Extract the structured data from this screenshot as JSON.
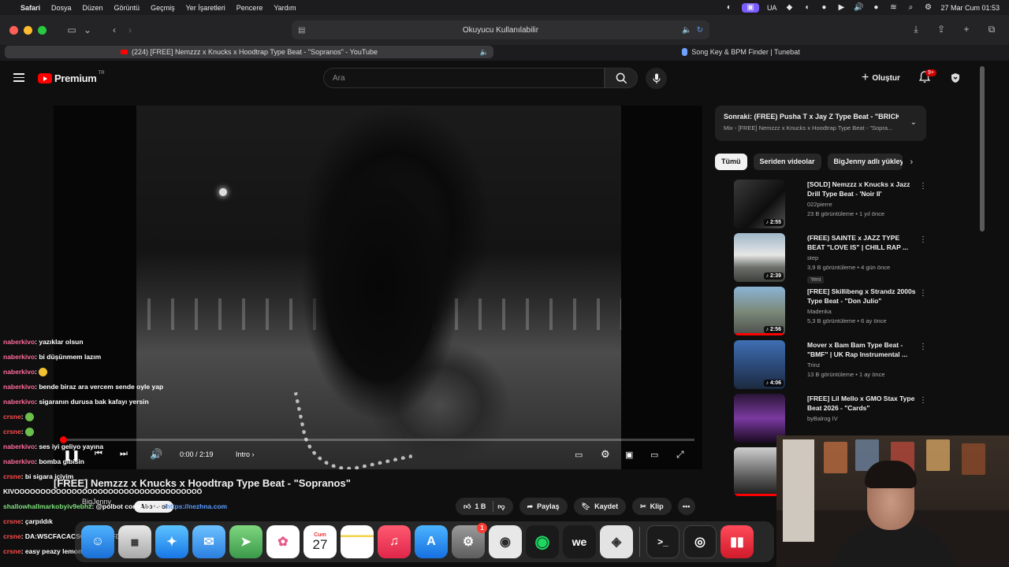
{
  "menubar": {
    "app": "Safari",
    "items": [
      "Dosya",
      "Düzen",
      "Görüntü",
      "Geçmiş",
      "Yer İşaretleri",
      "Pencere",
      "Yardım"
    ],
    "lang": "UA",
    "datetime": "27 Mar Cum  01:53"
  },
  "safari": {
    "address_text": "Okuyucu Kullanılabilir",
    "tabs": [
      {
        "label": "(224) [FREE] Nemzzz x Knucks x Hoodtrap Type Beat - \"Sopranos\" - YouTube",
        "active": true
      },
      {
        "label": "Song Key & BPM Finder | Tunebat",
        "active": false
      }
    ]
  },
  "yt": {
    "logo_text": "Premium",
    "logo_region": "TR",
    "search_placeholder": "Ara",
    "create_label": "Oluştur",
    "notif_badge": "9+"
  },
  "player": {
    "time": "0:00 / 2:19",
    "chapter": "Intro",
    "progress": 0.0
  },
  "video": {
    "title": "[FREE] Nemzzz x Knucks x Hoodtrap Type Beat - \"Sopranos\"",
    "channel": "BigJenny",
    "subscribe_label": "Abone ol",
    "likes": "1 B",
    "share": "Paylaş",
    "save": "Kaydet",
    "clip": "Klip"
  },
  "sidebar": {
    "next_title": "Sonraki: (FREE) Pusha T x Jay Z Type Beat - \"BRICK...",
    "next_sub": "Mix - [FREE] Nemzzz x Knucks x Hoodtrap Type Beat - \"Sopra...",
    "chips": [
      "Tümü",
      "Seriden videolar",
      "BigJenny adlı yükleyic"
    ],
    "items": [
      {
        "title": "[SOLD] Nemzzz x Knucks x Jazz Drill Type Beat - 'Noir II'",
        "channel": "022pierre",
        "meta": "23 B görüntüleme • 1 yıl önce",
        "duration": "2:55",
        "tag": ""
      },
      {
        "title": "(FREE) SAINTE x JAZZ TYPE BEAT \"LOVE IS\" | CHILL RAP ...",
        "channel": "step",
        "meta": "3,9 B görüntüleme • 4 gün önce",
        "duration": "2:39",
        "tag": "Yeni"
      },
      {
        "title": "[FREE] Skillibeng x Strandz 2000s Type Beat - \"Don Julio\"",
        "channel": "Madenka",
        "meta": "5,3 B görüntüleme • 6 ay önce",
        "duration": "2:56",
        "tag": ""
      },
      {
        "title": "Mover x Bam Bam Type Beat - \"BMF\" | UK Rap Instrumental ...",
        "channel": "Trinz",
        "meta": "13 B görüntüleme • 1 ay önce",
        "duration": "4:06",
        "tag": ""
      },
      {
        "title": "[FREE] Lil Mello x GMO Stax Type Beat 2026 - \"Cards\"",
        "channel": "byBalrog IV",
        "meta": "",
        "duration": "",
        "tag": ""
      }
    ]
  },
  "chat": [
    {
      "user": "naberkivo",
      "color": "#ff6b9a",
      "msg": ": yazıklar olsun"
    },
    {
      "user": "naberkivo",
      "color": "#ff6b9a",
      "msg": ": bi düşünmem lazım"
    },
    {
      "user": "naberkivo",
      "color": "#ff6b9a",
      "msg": ": ",
      "emoji": "y"
    },
    {
      "user": "naberkivo",
      "color": "#ff6b9a",
      "msg": ": bende biraz ara vercem sende oyle yap"
    },
    {
      "user": "naberkivo",
      "color": "#ff6b9a",
      "msg": ": sigaranın durusa bak kafayı yersin"
    },
    {
      "user": "crsne",
      "color": "#ff4d4d",
      "msg": ": ",
      "emoji": "g"
    },
    {
      "user": "crsne",
      "color": "#ff4d4d",
      "msg": ": ",
      "emoji": "g"
    },
    {
      "user": "naberkivo",
      "color": "#ff6b9a",
      "msg": ": ses iyi geliyo yayına"
    },
    {
      "user": "naberkivo",
      "color": "#ff6b9a",
      "msg": ": bomba gibisin"
    },
    {
      "user": "crsne",
      "color": "#ff4d4d",
      "msg": ": bi sigara içiyim"
    },
    {
      "user": "",
      "color": "#ffffff",
      "msg": "KIVOOOOOOOOOOOOOOOOOOOOOOOOOOOOOOOOOOOÖ"
    },
    {
      "user": "shallowhallmarkobyiv9ebhz",
      "color": "#7ee07e",
      "msg": ": @polbot come to us - ",
      "link": "https://nezhna.com"
    },
    {
      "user": "crsne",
      "color": "#ff4d4d",
      "msg": ": çarpıldık"
    },
    {
      "user": "crsne",
      "color": "#ff4d4d",
      "msg": ": DA:WSCFACACSQACWQAFDC"
    },
    {
      "user": "crsne",
      "color": "#ff4d4d",
      "msg": ": easy peazy lemon squezy"
    }
  ],
  "dock": {
    "calendar_month": "Cum",
    "calendar_day": "27",
    "settings_badge": "1"
  },
  "colors": {
    "yt_red": "#ff0000",
    "bg": "#0f0f0f",
    "chip_bg": "#272727"
  }
}
